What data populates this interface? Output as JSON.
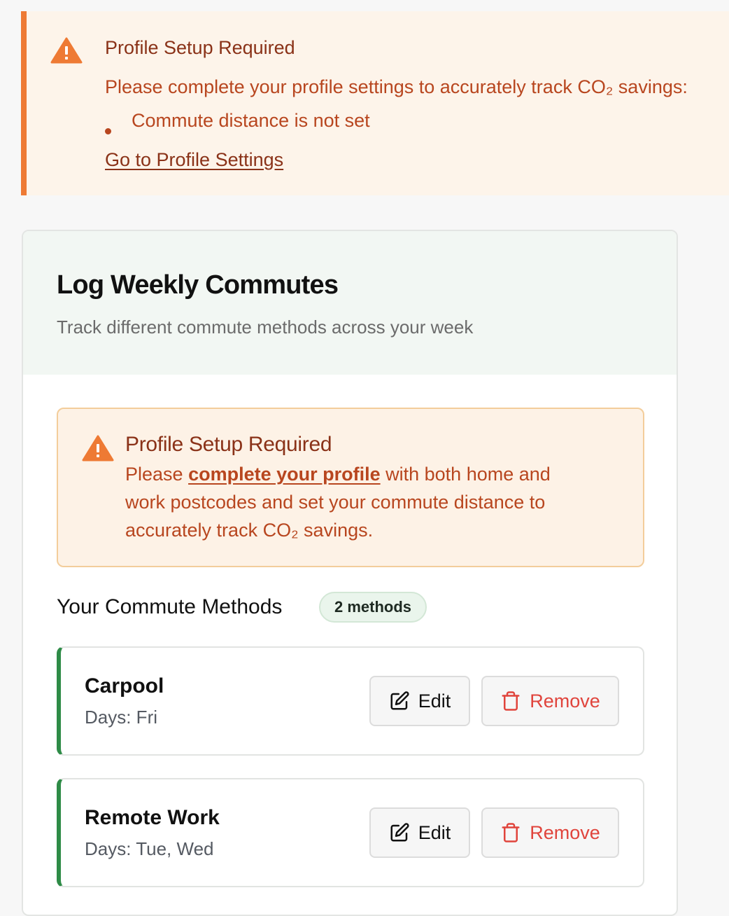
{
  "top_alert": {
    "title": "Profile Setup Required",
    "description": "Please complete your profile settings to accurately track CO₂ savings:",
    "issues": [
      "Commute distance is not set"
    ],
    "link_label": "Go to Profile Settings"
  },
  "card": {
    "title": "Log Weekly Commutes",
    "subtitle": "Track different commute methods across your week",
    "alert": {
      "title": "Profile Setup Required",
      "line1_prefix": "Please ",
      "line1_link": "complete your profile",
      "line1_suffix": " with both home and",
      "line2": "work postcodes and set your commute distance to",
      "line3": "accurately track CO₂ savings."
    },
    "methods_heading": "Your Commute Methods",
    "methods_count": "2 methods",
    "methods": [
      {
        "name": "Carpool",
        "days": "Days: Fri",
        "edit_label": "Edit",
        "remove_label": "Remove"
      },
      {
        "name": "Remote Work",
        "days": "Days: Tue, Wed",
        "edit_label": "Edit",
        "remove_label": "Remove"
      }
    ]
  },
  "colors": {
    "warning_accent": "#ee7a34",
    "warning_text": "#b8461f",
    "method_accent": "#2e8b47",
    "remove_red": "#e0443c"
  },
  "icons": {
    "alert": "warning-triangle-icon",
    "edit": "pencil-square-icon",
    "remove": "trash-icon"
  }
}
